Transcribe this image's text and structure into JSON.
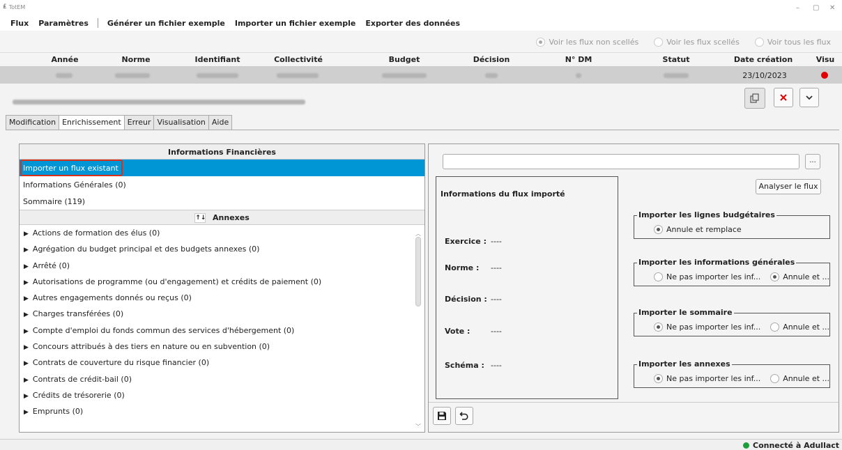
{
  "window": {
    "title": "TotEM",
    "minimize": "–",
    "maximize": "▢",
    "close": "✕"
  },
  "menu": {
    "items": [
      "Flux",
      "Paramètres",
      "Générer un fichier exemple",
      "Importer un fichier exemple",
      "Exporter des données"
    ]
  },
  "filters": [
    {
      "label": "Voir les flux non scellés",
      "selected": true
    },
    {
      "label": "Voir les flux scellés",
      "selected": false
    },
    {
      "label": "Voir tous les flux",
      "selected": false
    }
  ],
  "table": {
    "headers": [
      "Année",
      "Norme",
      "Identifiant",
      "Collectivité",
      "Budget",
      "Décision",
      "N° DM",
      "Statut",
      "Date création",
      "Visu"
    ],
    "row": {
      "date_creation": "23/10/2023",
      "visu_color": "#e00000"
    }
  },
  "tabs": [
    "Modification",
    "Enrichissement",
    "Erreur",
    "Visualisation",
    "Aide"
  ],
  "active_tab": "Enrichissement",
  "left": {
    "financial_header": "Informations Financières",
    "financial_items": [
      "Importer un flux existant",
      "Informations Générales (0)",
      "Sommaire (119)"
    ],
    "annexes_header": "Annexes",
    "sort_icon": "↑↓",
    "annexes": [
      "Actions de formation des élus (0)",
      "Agrégation du budget principal et des budgets annexes (0)",
      "Arrêté (0)",
      "Autorisations de programme (ou d'engagement) et crédits de paiement (0)",
      "Autres engagements donnés ou reçus (0)",
      "Charges transférées (0)",
      "Compte d'emploi du fonds commun des services d'hébergement (0)",
      "Concours attribués à des tiers en nature ou en subvention (0)",
      "Contrats de couverture du risque financier (0)",
      "Contrats de crédit-bail (0)",
      "Crédits de trésorerie (0)",
      "Emprunts (0)"
    ]
  },
  "right": {
    "browse_label": "...",
    "analyse_label": "Analyser le flux",
    "flow_title": "Informations du flux importé",
    "fields": [
      {
        "label": "Exercice :",
        "value": "----"
      },
      {
        "label": "Norme :",
        "value": "----"
      },
      {
        "label": "Décision :",
        "value": "----"
      },
      {
        "label": "Vote :",
        "value": "----"
      },
      {
        "label": "Schéma :",
        "value": "----"
      }
    ],
    "import_groups": [
      {
        "legend": "Importer les lignes budgétaires",
        "options": [
          {
            "label": "Annule et remplace",
            "selected": true
          }
        ]
      },
      {
        "legend": "Importer les informations générales",
        "options": [
          {
            "label": "Ne pas importer les inf...",
            "selected": false
          },
          {
            "label": "Annule et ...",
            "selected": true
          }
        ]
      },
      {
        "legend": "Importer le sommaire",
        "options": [
          {
            "label": "Ne pas importer les inf...",
            "selected": true
          },
          {
            "label": "Annule et ...",
            "selected": false
          }
        ]
      },
      {
        "legend": "Importer les annexes",
        "options": [
          {
            "label": "Ne pas importer les inf...",
            "selected": true
          },
          {
            "label": "Annule et ...",
            "selected": false
          }
        ]
      }
    ]
  },
  "status": {
    "connection": "Connecté à Adullact",
    "color": "#1b9e3b"
  }
}
